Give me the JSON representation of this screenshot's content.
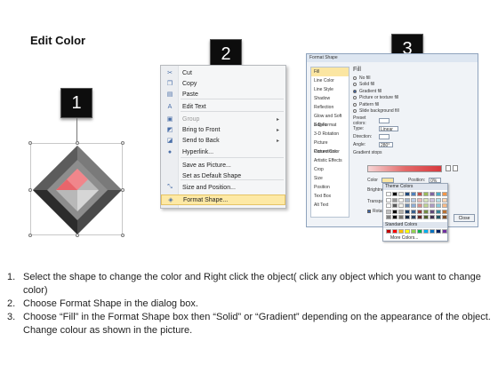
{
  "title": "Edit Color",
  "steps": [
    "1",
    "2",
    "3"
  ],
  "context_menu": {
    "items": [
      {
        "icon": "cut-icon",
        "glyph": "✂",
        "label": "Cut",
        "disabled": false,
        "submenu": false
      },
      {
        "icon": "copy-icon",
        "glyph": "❐",
        "label": "Copy",
        "disabled": false,
        "submenu": false
      },
      {
        "icon": "paste-icon",
        "glyph": "▤",
        "label": "Paste",
        "disabled": false,
        "submenu": false
      },
      {
        "icon": "edit-text-icon",
        "glyph": "A",
        "label": "Edit Text",
        "disabled": false,
        "submenu": false
      },
      {
        "icon": "group-icon",
        "glyph": "▣",
        "label": "Group",
        "disabled": true,
        "submenu": true
      },
      {
        "icon": "bring-front-icon",
        "glyph": "◩",
        "label": "Bring to Front",
        "disabled": false,
        "submenu": true
      },
      {
        "icon": "send-back-icon",
        "glyph": "◪",
        "label": "Send to Back",
        "disabled": false,
        "submenu": true
      },
      {
        "icon": "hyperlink-icon",
        "glyph": "●",
        "label": "Hyperlink...",
        "disabled": false,
        "submenu": false
      },
      {
        "icon": "",
        "glyph": "",
        "label": "Save as Picture...",
        "disabled": false,
        "submenu": false
      },
      {
        "icon": "",
        "glyph": "",
        "label": "Set as Default Shape",
        "disabled": false,
        "submenu": false
      },
      {
        "icon": "size-position-icon",
        "glyph": "⤡",
        "label": "Size and Position...",
        "disabled": false,
        "submenu": false
      },
      {
        "icon": "format-shape-icon",
        "glyph": "◈",
        "label": "Format Shape...",
        "disabled": false,
        "submenu": false,
        "highlighted": true
      }
    ]
  },
  "dialog": {
    "title": "Format Shape",
    "nav": [
      "Fill",
      "Line Color",
      "Line Style",
      "Shadow",
      "Reflection",
      "Glow and Soft Edges",
      "3-D Format",
      "3-D Rotation",
      "Picture Corrections",
      "Picture Color",
      "Artistic Effects",
      "Crop",
      "Size",
      "Position",
      "Text Box",
      "Alt Text"
    ],
    "heading": "Fill",
    "fill_options": [
      {
        "label": "No fill",
        "selected": false
      },
      {
        "label": "Solid fill",
        "selected": false
      },
      {
        "label": "Gradient fill",
        "selected": true
      },
      {
        "label": "Picture or texture fill",
        "selected": false
      },
      {
        "label": "Pattern fill",
        "selected": false
      },
      {
        "label": "Slide background fill",
        "selected": false
      }
    ],
    "preset_label": "Preset colors:",
    "type_label": "Type:",
    "type_value": "Linear",
    "direction_label": "Direction:",
    "angle_label": "Angle:",
    "angle_value": "280°",
    "stops_label": "Gradient stops",
    "color_label": "Color",
    "position_label": "Position:",
    "position_value": "0%",
    "brightness_label": "Brightness",
    "transparency_label": "Transpare",
    "rotate_label": "Rotate",
    "theme_colors_label": "Theme Colors",
    "standard_colors_label": "Standard Colors",
    "more_colors_label": "More Colors...",
    "close_label": "Close"
  },
  "instructions": [
    {
      "num": "1.",
      "text": "Select the shape to change the color and Right click the object( click any object which you want to change color)"
    },
    {
      "num": "2.",
      "text": "Choose Format Shape in the dialog box."
    },
    {
      "num": "3.",
      "text": "Choose “Fill” in the Format Shape box then “Solid” or “Gradient” depending on the appearance of the object. Change colour as shown in the picture."
    }
  ],
  "colors": {
    "badge": "#0d0d0d",
    "highlight": "#fde9a5",
    "shape_dark": "#3a3a3a",
    "shape_accent": "#e8656b",
    "theme_row": [
      "#ffffff",
      "#000000",
      "#eeece1",
      "#1f497d",
      "#4f81bd",
      "#c0504d",
      "#9bbb59",
      "#8064a2",
      "#4bacc6",
      "#f79646"
    ],
    "standard_row": [
      "#c00000",
      "#ff0000",
      "#ffc000",
      "#ffff00",
      "#92d050",
      "#00b050",
      "#00b0f0",
      "#0070c0",
      "#002060",
      "#7030a0"
    ]
  }
}
